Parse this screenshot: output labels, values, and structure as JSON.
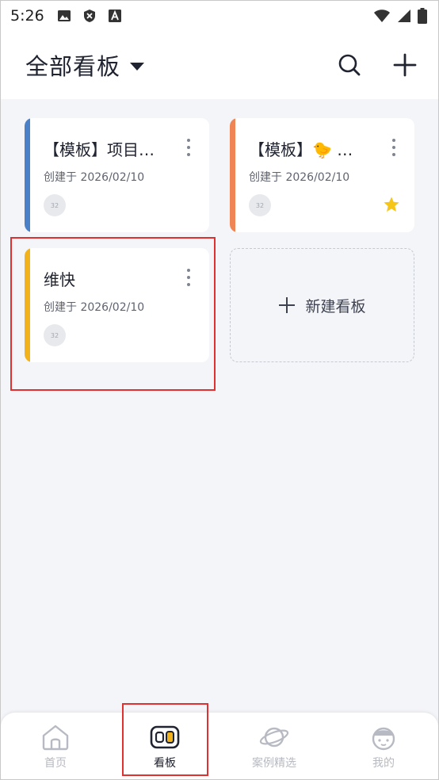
{
  "status_bar": {
    "time": "5:26",
    "icons": [
      "image-icon",
      "shield-icon",
      "font-icon"
    ],
    "right_icons": [
      "wifi-icon",
      "signal-icon",
      "battery-icon"
    ]
  },
  "header": {
    "title": "全部看板",
    "caret_icon": "caret-down-icon",
    "search_icon": "search-icon",
    "add_icon": "plus-icon"
  },
  "boards": [
    {
      "title": "【模板】项目…",
      "date": "创建于 2026/02/10",
      "avatar": "32",
      "accent": "#4a80c8",
      "starred": false
    },
    {
      "title": "【模板】🐤 …",
      "date": "创建于 2026/02/10",
      "avatar": "32",
      "accent": "#ef8454",
      "starred": true
    },
    {
      "title": "维快",
      "date": "创建于 2026/02/10",
      "avatar": "32",
      "accent": "#f2b21b",
      "starred": false
    }
  ],
  "new_board": {
    "label": "新建看板"
  },
  "bottom_nav": {
    "items": [
      {
        "label": "首页",
        "icon": "home-icon",
        "active": false
      },
      {
        "label": "看板",
        "icon": "board-icon",
        "active": true
      },
      {
        "label": "案例精选",
        "icon": "planet-icon",
        "active": false
      },
      {
        "label": "我的",
        "icon": "profile-face-icon",
        "active": false
      }
    ]
  },
  "colors": {
    "background": "#f4f5f9",
    "highlight": "#e03030",
    "star": "#f5c518",
    "active_nav": "#202330",
    "inactive_nav": "#b7bac2"
  }
}
